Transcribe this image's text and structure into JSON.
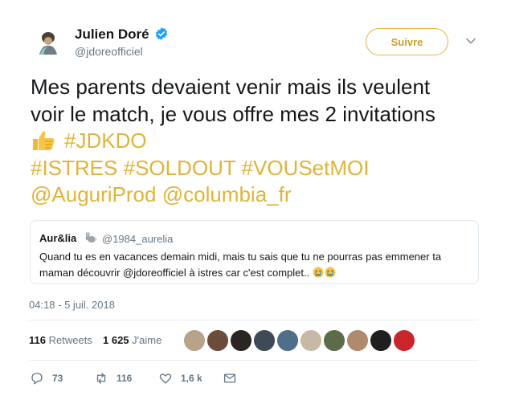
{
  "author": {
    "name": "Julien Doré",
    "handle": "@jdoreofficiel",
    "verified": true,
    "avatar_icon": "avatar-icon"
  },
  "follow_button": {
    "label": "Suivre",
    "accent": "#e0b43a"
  },
  "menu_icon": "chevron-down-icon",
  "tweet": {
    "text_line1": "Mes parents devaient venir mais ils veulent",
    "text_line2": "voir le match, je vous offre mes 2 invitations",
    "emoji": "thumbs-up-icon",
    "hashtag1": "#JDKDO",
    "hashtag2": "#ISTRES",
    "hashtag3": "#SOLDOUT",
    "hashtag4": "#VOUSetMOI",
    "mention1": "@AuguriProd",
    "mention2": "@columbia_fr",
    "link_color": "#e0b43a"
  },
  "quoted": {
    "name": "Aur&lia",
    "badge_icon": "rabbit-icon",
    "handle": "@1984_aurelia",
    "text_line1": "Quand tu es en vacances demain midi,  mais tu sais que tu ne pourras pas emmener ta",
    "text_line2": "maman découvrir @jdoreofficiel à istres car c'est complet..",
    "emojis": [
      "crying-face-icon",
      "crying-face-icon"
    ]
  },
  "timestamp": "04:18 - 5 juil. 2018",
  "stats": {
    "retweets_count": "116",
    "retweets_label": "Retweets",
    "likes_count": "1 625",
    "likes_label": "J'aime",
    "liker_avatars": 10
  },
  "actions": {
    "reply_count": "73",
    "retweet_count": "116",
    "like_count": "1,6 k",
    "reply_icon": "reply-icon",
    "retweet_icon": "retweet-icon",
    "like_icon": "heart-icon",
    "dm_icon": "envelope-icon"
  }
}
